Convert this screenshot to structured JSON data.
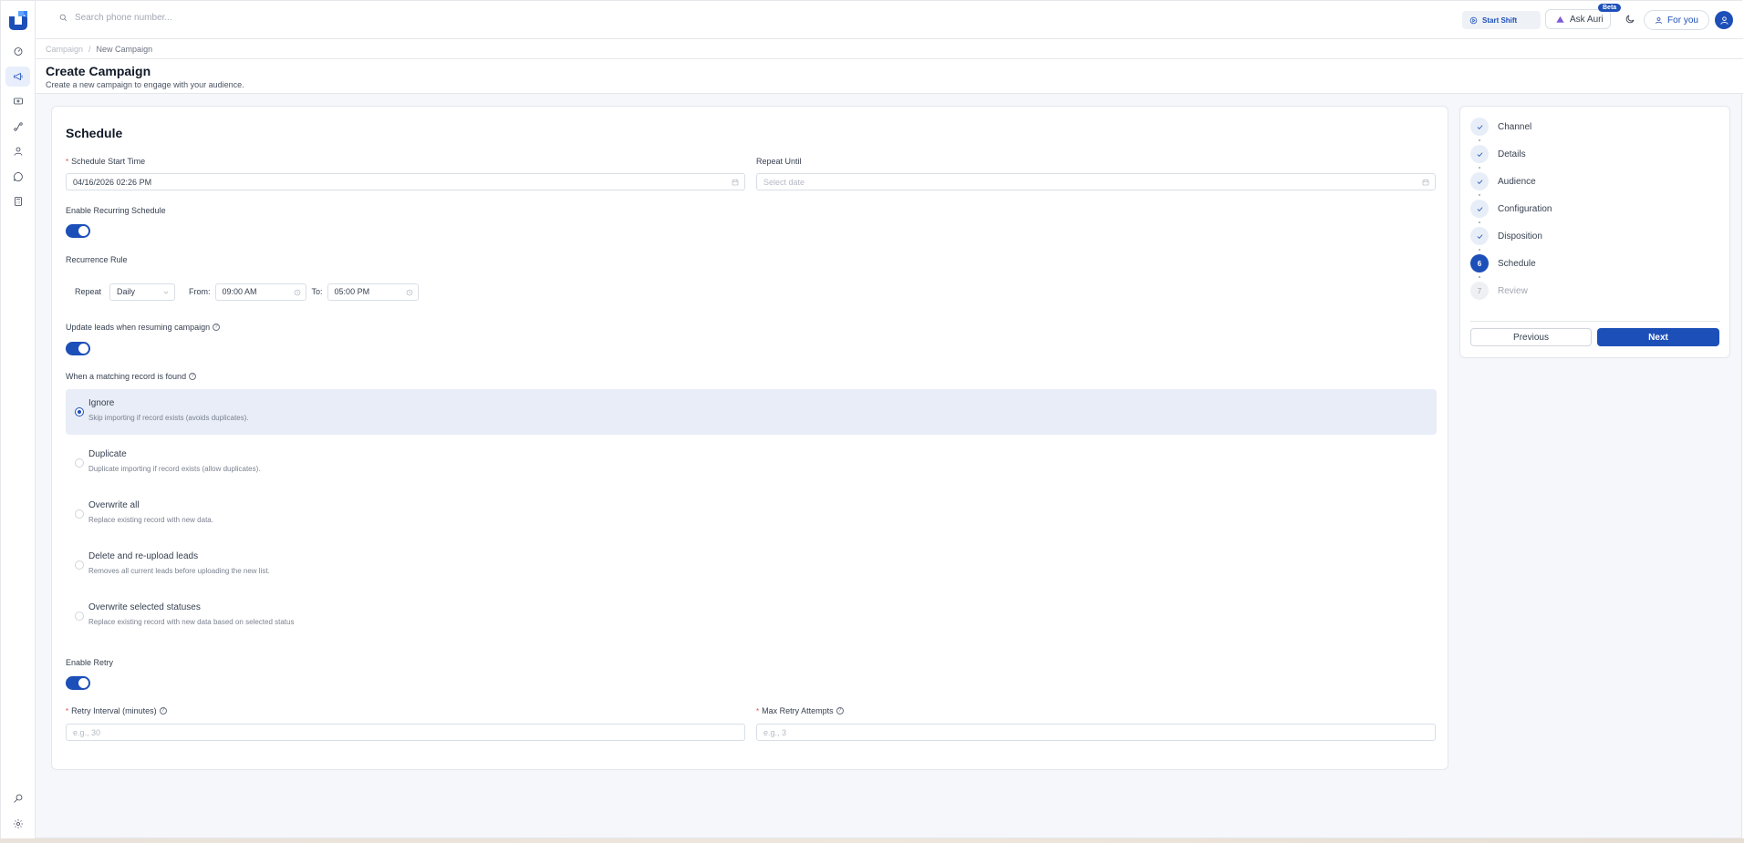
{
  "colors": {
    "accent": "#1d4fb8",
    "selected_bg": "#e8edf7",
    "required": "#ef4444"
  },
  "sidebar": {
    "logo_icon": "app-logo",
    "items": [
      {
        "icon": "dashboard-icon"
      },
      {
        "icon": "megaphone-icon",
        "active": true
      },
      {
        "icon": "ticket-icon"
      },
      {
        "icon": "route-icon"
      },
      {
        "icon": "user-icon"
      },
      {
        "icon": "chat-icon"
      },
      {
        "icon": "calculator-icon"
      }
    ],
    "bottom_items": [
      {
        "icon": "search-key-icon"
      },
      {
        "icon": "gear-icon"
      }
    ]
  },
  "topbar": {
    "search_placeholder": "Search phone number...",
    "start_shift": "Start Shift",
    "ask_auri": "Ask Auri",
    "beta": "Beta",
    "for_you": "For you"
  },
  "breadcrumb": {
    "root": "Campaign",
    "sep": "/",
    "current": "New Campaign"
  },
  "page": {
    "title": "Create Campaign",
    "subtitle": "Create a new campaign to engage with your audience."
  },
  "schedule": {
    "heading": "Schedule",
    "start_time_label": "Schedule Start Time",
    "start_time_value": "04/16/2026 02:26 PM",
    "repeat_until_label": "Repeat Until",
    "repeat_until_placeholder": "Select date",
    "recurring_label": "Enable Recurring Schedule",
    "recurring_on": true,
    "recurrence_label": "Recurrence Rule",
    "repeat_label": "Repeat",
    "repeat_value": "Daily",
    "from_label": "From:",
    "from_value": "09:00 AM",
    "to_label": "To:",
    "to_value": "05:00 PM",
    "update_leads_label": "Update leads when resuming campaign",
    "update_leads_on": true,
    "matching_label": "When a matching record is found",
    "options": [
      {
        "title": "Ignore",
        "desc": "Skip importing if record exists (avoids duplicates).",
        "selected": true
      },
      {
        "title": "Duplicate",
        "desc": "Duplicate importing if record exists (allow duplicates).",
        "selected": false
      },
      {
        "title": "Overwrite all",
        "desc": "Replace existing record with new data.",
        "selected": false
      },
      {
        "title": "Delete and re-upload leads",
        "desc": "Removes all current leads before uploading the new list.",
        "selected": false
      },
      {
        "title": "Overwrite selected statuses",
        "desc": "Replace existing record with new data based on selected status",
        "selected": false
      }
    ],
    "retry_label": "Enable Retry",
    "retry_on": true,
    "retry_interval_label": "Retry Interval (minutes)",
    "retry_interval_placeholder": "e.g., 30",
    "max_retry_label": "Max Retry Attempts",
    "max_retry_placeholder": "e.g., 3"
  },
  "stepper": {
    "steps": [
      {
        "label": "Channel",
        "state": "done"
      },
      {
        "label": "Details",
        "state": "done"
      },
      {
        "label": "Audience",
        "state": "done"
      },
      {
        "label": "Configuration",
        "state": "done"
      },
      {
        "label": "Disposition",
        "state": "done"
      },
      {
        "label": "Schedule",
        "state": "current",
        "num": "6"
      },
      {
        "label": "Review",
        "state": "todo",
        "num": "7"
      }
    ],
    "previous": "Previous",
    "next": "Next"
  }
}
